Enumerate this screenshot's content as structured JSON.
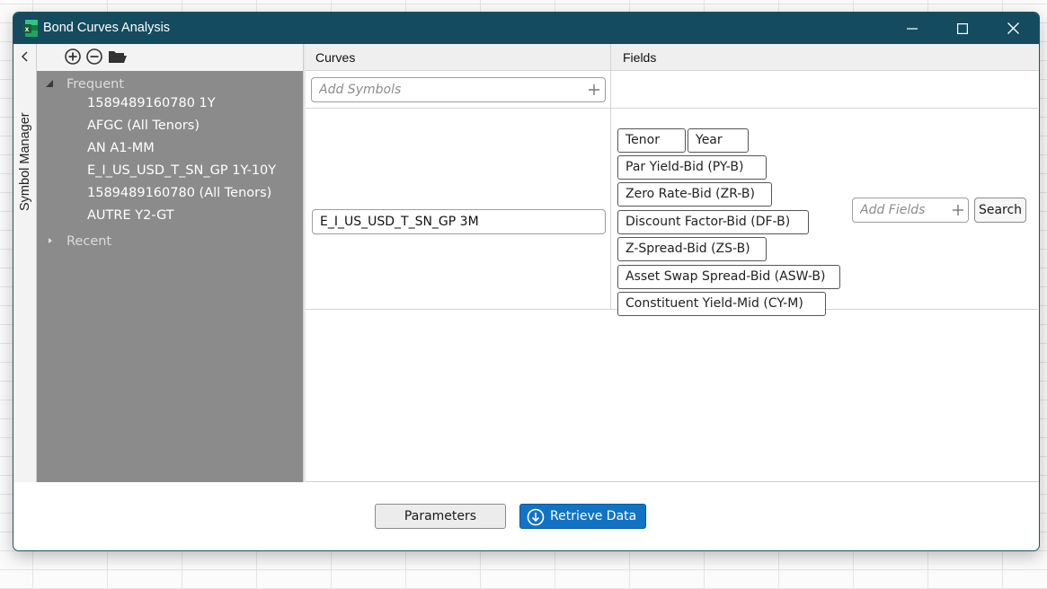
{
  "window": {
    "title": "Bond Curves Analysis",
    "controls": [
      "minimize",
      "maximize",
      "close"
    ],
    "app_icon": "excel-icon"
  },
  "sidebar": {
    "label": "Symbol Manager",
    "toolbar_icons": [
      "add-circle-icon",
      "remove-circle-icon",
      "folder-open-icon"
    ],
    "groups": [
      {
        "label": "Frequent",
        "expanded": true,
        "items": [
          "1589489160780 1Y",
          "AFGC (All Tenors)",
          "AN A1-MM",
          "E_I_US_USD_T_SN_GP 1Y-10Y",
          "1589489160780 (All Tenors)",
          "AUTRE Y2-GT"
        ]
      },
      {
        "label": "Recent",
        "expanded": false,
        "items": []
      }
    ]
  },
  "grid": {
    "headers": {
      "curves": "Curves",
      "fields": "Fields"
    },
    "add_symbols_placeholder": "Add Symbols",
    "curve_value": "E_I_US_USD_T_SN_GP 3M",
    "fields": [
      "Tenor",
      "Year",
      "Par Yield-Bid (PY-B)",
      "Zero Rate-Bid (ZR-B)",
      "Discount Factor-Bid (DF-B)",
      "Z-Spread-Bid (ZS-B)",
      "Asset Swap Spread-Bid (ASW-B)",
      "Constituent Yield-Mid (CY-M)"
    ],
    "add_fields_placeholder": "Add Fields",
    "search_label": "Search"
  },
  "footer": {
    "parameters_label": "Parameters",
    "retrieve_label": "Retrieve Data"
  },
  "colors": {
    "titlebar": "#154b5e",
    "tree_bg": "#8b8b8b",
    "primary_button": "#1273c5"
  }
}
